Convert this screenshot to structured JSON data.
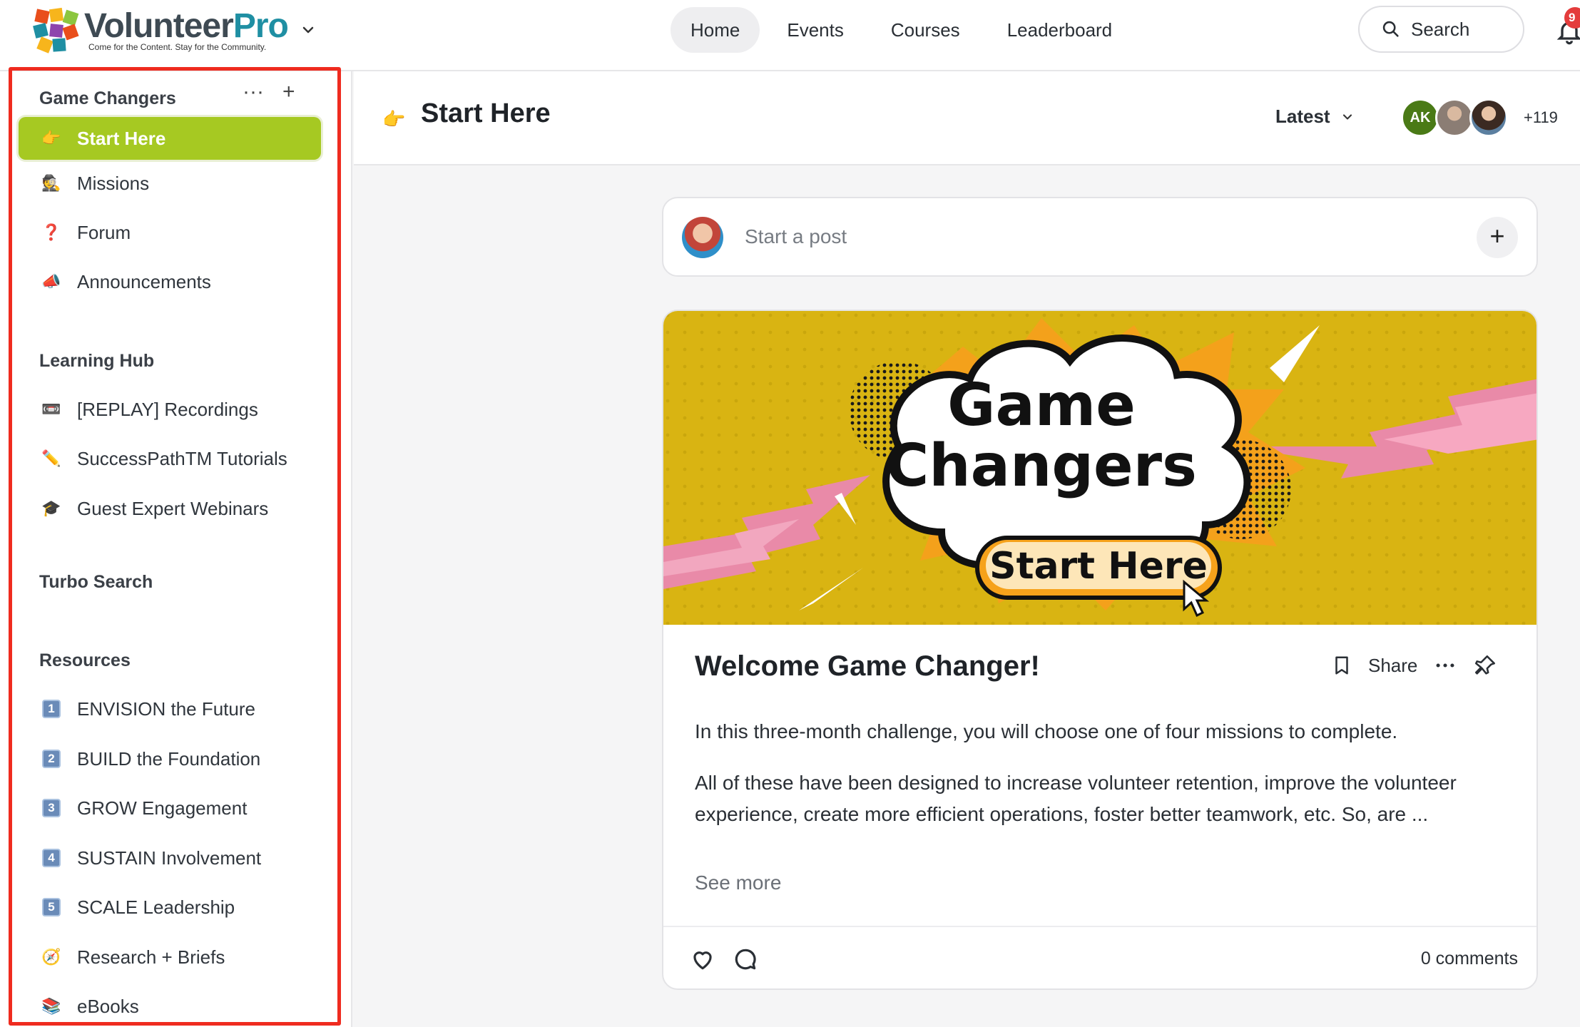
{
  "brand": {
    "name_part1": "Volunteer",
    "name_part2": "Pro",
    "tagline": "Come for the Content. Stay for the Community."
  },
  "nav": {
    "items": [
      {
        "label": "Home",
        "active": true
      },
      {
        "label": "Events",
        "active": false
      },
      {
        "label": "Courses",
        "active": false
      },
      {
        "label": "Leaderboard",
        "active": false
      }
    ],
    "search_label": "Search",
    "notification_count": "9"
  },
  "sidebar": {
    "sections": [
      {
        "title": "Game Changers",
        "items": [
          {
            "icon": "pointing-hand-icon",
            "emoji": "👉",
            "label": "Start Here",
            "active": true
          },
          {
            "icon": "detective-icon",
            "emoji": "🕵",
            "label": "Missions"
          },
          {
            "icon": "question-mark-icon",
            "emoji": "❓",
            "label": "Forum"
          },
          {
            "icon": "megaphone-icon",
            "emoji": "📣",
            "label": "Announcements"
          }
        ]
      },
      {
        "title": "Learning Hub",
        "items": [
          {
            "icon": "videocassette-icon",
            "emoji": "📼",
            "label": "[REPLAY] Recordings"
          },
          {
            "icon": "pencil-icon",
            "emoji": "✏️",
            "label": "SuccessPathTM Tutorials"
          },
          {
            "icon": "graduation-cap-icon",
            "emoji": "🎓",
            "label": "Guest Expert Webinars"
          }
        ]
      },
      {
        "title": "Turbo Search",
        "items": []
      },
      {
        "title": "Resources",
        "items": [
          {
            "icon": "keycap-1-icon",
            "emoji": "1",
            "label": "ENVISION the Future"
          },
          {
            "icon": "keycap-2-icon",
            "emoji": "2",
            "label": "BUILD the Foundation"
          },
          {
            "icon": "keycap-3-icon",
            "emoji": "3",
            "label": "GROW Engagement"
          },
          {
            "icon": "keycap-4-icon",
            "emoji": "4",
            "label": "SUSTAIN Involvement"
          },
          {
            "icon": "keycap-5-icon",
            "emoji": "5",
            "label": "SCALE Leadership"
          },
          {
            "icon": "compass-icon",
            "emoji": "🧭",
            "label": "Research + Briefs"
          },
          {
            "icon": "books-icon",
            "emoji": "📚",
            "label": "eBooks"
          }
        ]
      }
    ],
    "section_more_label": "···",
    "section_add_label": "+"
  },
  "page": {
    "title": "Start Here",
    "emoji": "👉",
    "sort_label": "Latest",
    "avatars": [
      {
        "initials": "AK",
        "color": "#4a7a16"
      },
      {
        "initials": "",
        "color": "#9d8f86"
      },
      {
        "initials": "",
        "color": "#5a4336"
      }
    ],
    "member_more": "+119"
  },
  "composer": {
    "placeholder": "Start a post",
    "add_label": "+"
  },
  "post": {
    "banner": {
      "line1": "Game",
      "line2": "Changers",
      "button": "Start Here",
      "bg_color": "#d9b412"
    },
    "title": "Welcome Game Changer!",
    "share_label": "Share",
    "paragraph1": "In this three-month challenge, you will choose one of four missions to complete.",
    "paragraph2": "All of these have been designed to increase volunteer retention, improve the volunteer experience, create more efficient operations, foster better teamwork, etc. So, are ...",
    "see_more": "See more",
    "comments": "0 comments"
  },
  "colors": {
    "accent_green": "#a6c922",
    "highlight_red": "#ef2b1f",
    "brand_teal": "#1f8fa3"
  }
}
